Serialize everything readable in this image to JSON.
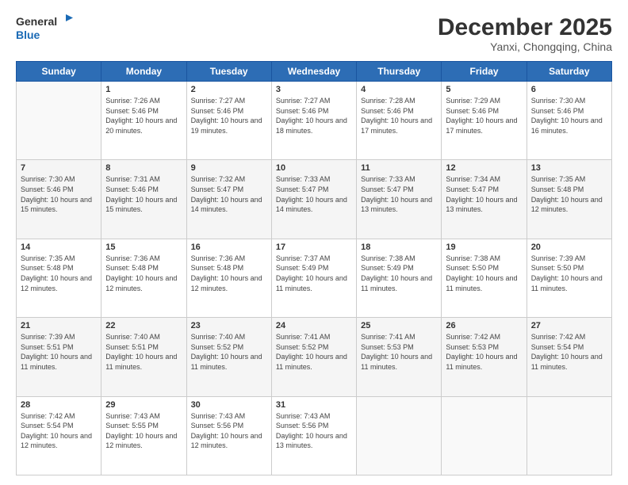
{
  "header": {
    "logo_line1": "General",
    "logo_line2": "Blue",
    "month": "December 2025",
    "location": "Yanxi, Chongqing, China"
  },
  "weekdays": [
    "Sunday",
    "Monday",
    "Tuesday",
    "Wednesday",
    "Thursday",
    "Friday",
    "Saturday"
  ],
  "weeks": [
    [
      {
        "day": "",
        "sunrise": "",
        "sunset": "",
        "daylight": ""
      },
      {
        "day": "1",
        "sunrise": "Sunrise: 7:26 AM",
        "sunset": "Sunset: 5:46 PM",
        "daylight": "Daylight: 10 hours and 20 minutes."
      },
      {
        "day": "2",
        "sunrise": "Sunrise: 7:27 AM",
        "sunset": "Sunset: 5:46 PM",
        "daylight": "Daylight: 10 hours and 19 minutes."
      },
      {
        "day": "3",
        "sunrise": "Sunrise: 7:27 AM",
        "sunset": "Sunset: 5:46 PM",
        "daylight": "Daylight: 10 hours and 18 minutes."
      },
      {
        "day": "4",
        "sunrise": "Sunrise: 7:28 AM",
        "sunset": "Sunset: 5:46 PM",
        "daylight": "Daylight: 10 hours and 17 minutes."
      },
      {
        "day": "5",
        "sunrise": "Sunrise: 7:29 AM",
        "sunset": "Sunset: 5:46 PM",
        "daylight": "Daylight: 10 hours and 17 minutes."
      },
      {
        "day": "6",
        "sunrise": "Sunrise: 7:30 AM",
        "sunset": "Sunset: 5:46 PM",
        "daylight": "Daylight: 10 hours and 16 minutes."
      }
    ],
    [
      {
        "day": "7",
        "sunrise": "Sunrise: 7:30 AM",
        "sunset": "Sunset: 5:46 PM",
        "daylight": "Daylight: 10 hours and 15 minutes."
      },
      {
        "day": "8",
        "sunrise": "Sunrise: 7:31 AM",
        "sunset": "Sunset: 5:46 PM",
        "daylight": "Daylight: 10 hours and 15 minutes."
      },
      {
        "day": "9",
        "sunrise": "Sunrise: 7:32 AM",
        "sunset": "Sunset: 5:47 PM",
        "daylight": "Daylight: 10 hours and 14 minutes."
      },
      {
        "day": "10",
        "sunrise": "Sunrise: 7:33 AM",
        "sunset": "Sunset: 5:47 PM",
        "daylight": "Daylight: 10 hours and 14 minutes."
      },
      {
        "day": "11",
        "sunrise": "Sunrise: 7:33 AM",
        "sunset": "Sunset: 5:47 PM",
        "daylight": "Daylight: 10 hours and 13 minutes."
      },
      {
        "day": "12",
        "sunrise": "Sunrise: 7:34 AM",
        "sunset": "Sunset: 5:47 PM",
        "daylight": "Daylight: 10 hours and 13 minutes."
      },
      {
        "day": "13",
        "sunrise": "Sunrise: 7:35 AM",
        "sunset": "Sunset: 5:48 PM",
        "daylight": "Daylight: 10 hours and 12 minutes."
      }
    ],
    [
      {
        "day": "14",
        "sunrise": "Sunrise: 7:35 AM",
        "sunset": "Sunset: 5:48 PM",
        "daylight": "Daylight: 10 hours and 12 minutes."
      },
      {
        "day": "15",
        "sunrise": "Sunrise: 7:36 AM",
        "sunset": "Sunset: 5:48 PM",
        "daylight": "Daylight: 10 hours and 12 minutes."
      },
      {
        "day": "16",
        "sunrise": "Sunrise: 7:36 AM",
        "sunset": "Sunset: 5:48 PM",
        "daylight": "Daylight: 10 hours and 12 minutes."
      },
      {
        "day": "17",
        "sunrise": "Sunrise: 7:37 AM",
        "sunset": "Sunset: 5:49 PM",
        "daylight": "Daylight: 10 hours and 11 minutes."
      },
      {
        "day": "18",
        "sunrise": "Sunrise: 7:38 AM",
        "sunset": "Sunset: 5:49 PM",
        "daylight": "Daylight: 10 hours and 11 minutes."
      },
      {
        "day": "19",
        "sunrise": "Sunrise: 7:38 AM",
        "sunset": "Sunset: 5:50 PM",
        "daylight": "Daylight: 10 hours and 11 minutes."
      },
      {
        "day": "20",
        "sunrise": "Sunrise: 7:39 AM",
        "sunset": "Sunset: 5:50 PM",
        "daylight": "Daylight: 10 hours and 11 minutes."
      }
    ],
    [
      {
        "day": "21",
        "sunrise": "Sunrise: 7:39 AM",
        "sunset": "Sunset: 5:51 PM",
        "daylight": "Daylight: 10 hours and 11 minutes."
      },
      {
        "day": "22",
        "sunrise": "Sunrise: 7:40 AM",
        "sunset": "Sunset: 5:51 PM",
        "daylight": "Daylight: 10 hours and 11 minutes."
      },
      {
        "day": "23",
        "sunrise": "Sunrise: 7:40 AM",
        "sunset": "Sunset: 5:52 PM",
        "daylight": "Daylight: 10 hours and 11 minutes."
      },
      {
        "day": "24",
        "sunrise": "Sunrise: 7:41 AM",
        "sunset": "Sunset: 5:52 PM",
        "daylight": "Daylight: 10 hours and 11 minutes."
      },
      {
        "day": "25",
        "sunrise": "Sunrise: 7:41 AM",
        "sunset": "Sunset: 5:53 PM",
        "daylight": "Daylight: 10 hours and 11 minutes."
      },
      {
        "day": "26",
        "sunrise": "Sunrise: 7:42 AM",
        "sunset": "Sunset: 5:53 PM",
        "daylight": "Daylight: 10 hours and 11 minutes."
      },
      {
        "day": "27",
        "sunrise": "Sunrise: 7:42 AM",
        "sunset": "Sunset: 5:54 PM",
        "daylight": "Daylight: 10 hours and 11 minutes."
      }
    ],
    [
      {
        "day": "28",
        "sunrise": "Sunrise: 7:42 AM",
        "sunset": "Sunset: 5:54 PM",
        "daylight": "Daylight: 10 hours and 12 minutes."
      },
      {
        "day": "29",
        "sunrise": "Sunrise: 7:43 AM",
        "sunset": "Sunset: 5:55 PM",
        "daylight": "Daylight: 10 hours and 12 minutes."
      },
      {
        "day": "30",
        "sunrise": "Sunrise: 7:43 AM",
        "sunset": "Sunset: 5:56 PM",
        "daylight": "Daylight: 10 hours and 12 minutes."
      },
      {
        "day": "31",
        "sunrise": "Sunrise: 7:43 AM",
        "sunset": "Sunset: 5:56 PM",
        "daylight": "Daylight: 10 hours and 13 minutes."
      },
      {
        "day": "",
        "sunrise": "",
        "sunset": "",
        "daylight": ""
      },
      {
        "day": "",
        "sunrise": "",
        "sunset": "",
        "daylight": ""
      },
      {
        "day": "",
        "sunrise": "",
        "sunset": "",
        "daylight": ""
      }
    ]
  ]
}
